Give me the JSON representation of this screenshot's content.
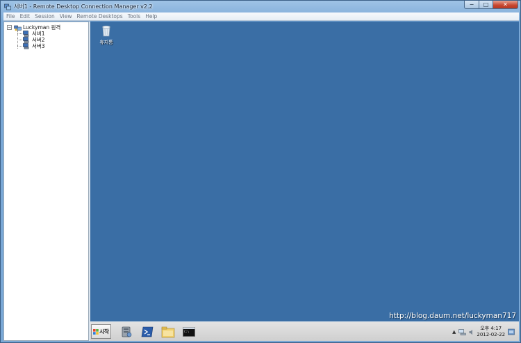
{
  "window": {
    "title": "서버1 - Remote Desktop Connection Manager v2.2",
    "minimize_glyph": "−",
    "maximize_glyph": "□",
    "close_glyph": "✕"
  },
  "menu": {
    "items": [
      "File",
      "Edit",
      "Session",
      "View",
      "Remote Desktops",
      "Tools",
      "Help"
    ]
  },
  "tree": {
    "root": {
      "label": "Luckyman 원격",
      "expander": "−"
    },
    "children": [
      {
        "label": "서버1"
      },
      {
        "label": "서버2"
      },
      {
        "label": "서버3"
      }
    ]
  },
  "desktop": {
    "background_color": "#3a6ea5",
    "recycle_bin_label": "휴지통",
    "watermark": "http://blog.daum.net/luckyman717"
  },
  "taskbar": {
    "start_label": "시작",
    "pinned": [
      "server-manager-icon",
      "powershell-icon",
      "explorer-icon",
      "cmd-icon"
    ],
    "tray_arrow": "▲",
    "clock_time": "오후 4:17",
    "clock_date": "2012-02-22"
  }
}
